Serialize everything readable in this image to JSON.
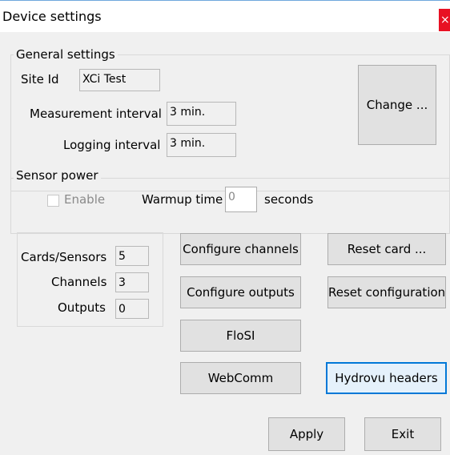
{
  "window": {
    "title": "Device settings",
    "close_glyph": "×"
  },
  "general": {
    "legend": "General settings",
    "site_id_label": "Site Id",
    "site_id_value": "XCi Test",
    "measurement_label": "Measurement interval",
    "measurement_value": "3 min.",
    "logging_label": "Logging interval",
    "logging_value": "3 min.",
    "change_label": "Change ..."
  },
  "sensor_power": {
    "legend": "Sensor power",
    "enable_label": "Enable",
    "enable_checked": false,
    "warmup_label": "Warmup time",
    "warmup_value": "0",
    "warmup_unit": "seconds"
  },
  "counts": {
    "cards_label": "Cards/Sensors",
    "cards_value": "5",
    "channels_label": "Channels",
    "channels_value": "3",
    "outputs_label": "Outputs",
    "outputs_value": "0"
  },
  "buttons": {
    "configure_channels": "Configure channels",
    "reset_card": "Reset card ...",
    "configure_outputs": "Configure outputs",
    "reset_configuration": "Reset configuration",
    "flosi": "FloSI",
    "webcomm": "WebComm",
    "hydrovu_headers": "Hydrovu headers",
    "apply": "Apply",
    "exit": "Exit"
  },
  "colors": {
    "accent": "#0078d7",
    "close": "#e81123",
    "face": "#f0f0f0"
  }
}
